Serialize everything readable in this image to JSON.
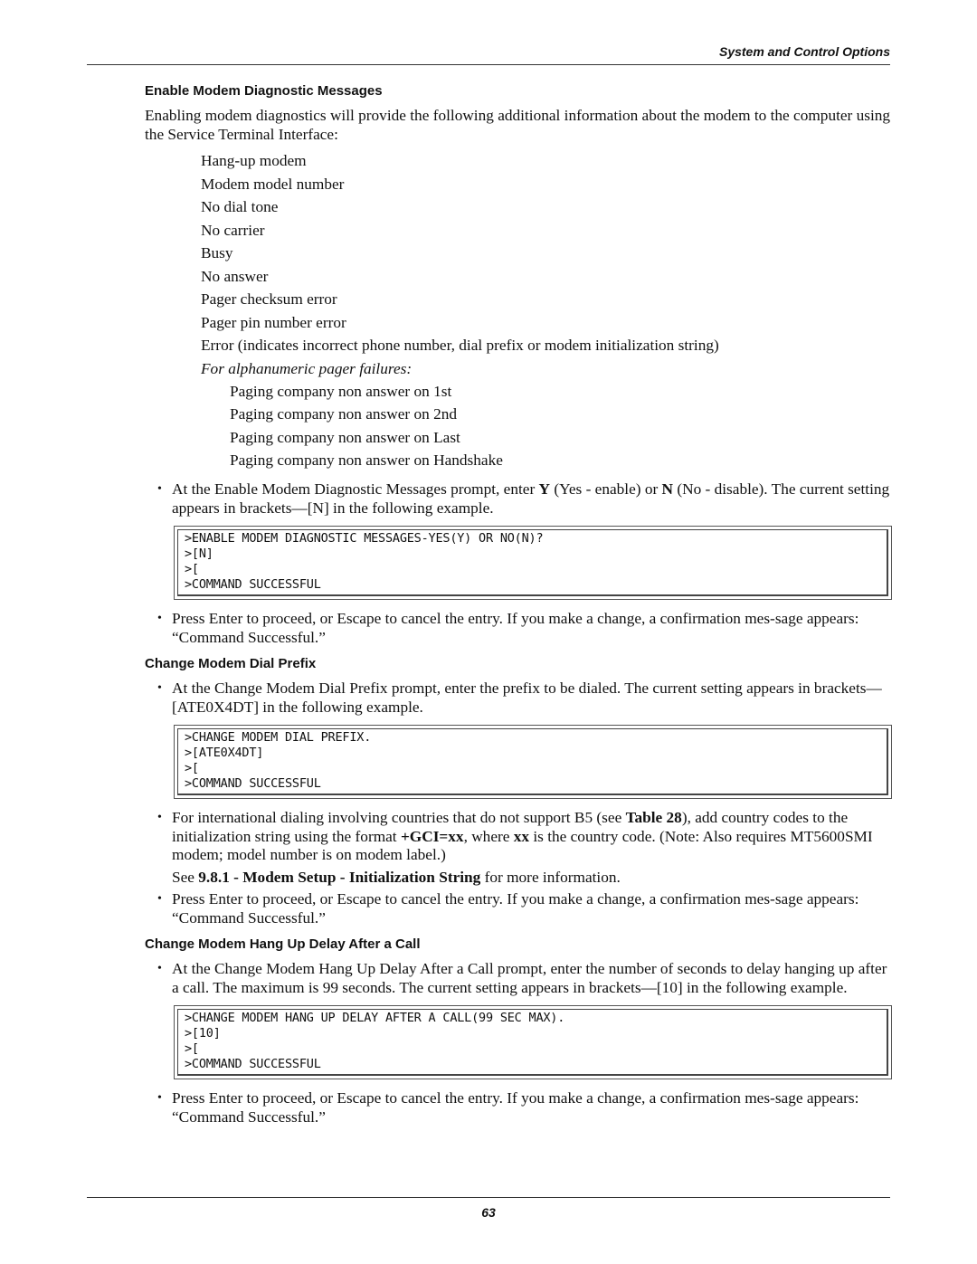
{
  "header": {
    "title": "System and Control Options"
  },
  "footer": {
    "page_number": "63"
  },
  "sections": [
    {
      "heading": "Enable Modem Diagnostic Messages",
      "intro": "Enabling modem diagnostics will provide the following additional information about the modem to the computer using the Service Terminal Interface:",
      "items": [
        "Hang-up modem",
        "Modem model number",
        "No dial tone",
        "No carrier",
        "Busy",
        "No answer",
        "Pager checksum error",
        "Pager pin number error",
        "Error (indicates incorrect phone number, dial prefix or modem initialization string)"
      ],
      "subheading": "For alphanumeric pager failures:",
      "subitems": [
        "Paging company non answer on 1st",
        "Paging company non answer on 2nd",
        "Paging company non answer on Last",
        "Paging company non answer on Handshake"
      ],
      "bullet1": {
        "pre": "At the Enable Modem Diagnostic Messages prompt, enter ",
        "y": "Y",
        "mid": " (Yes - enable) or ",
        "n": "N",
        "post": " (No - disable). The current setting appears in brackets—[N] in the following example."
      },
      "terminal": [
        ">ENABLE MODEM DIAGNOSTIC MESSAGES-YES(Y) OR NO(N)?",
        ">[N]",
        ">[",
        ">COMMAND SUCCESSFUL"
      ],
      "bullet2": "Press Enter to proceed, or Escape to cancel the entry. If you make a change, a confirmation mes-sage appears: “Command Successful.”"
    },
    {
      "heading": "Change Modem Dial Prefix",
      "bullet1": "At the Change Modem Dial Prefix prompt, enter the prefix to be dialed. The current setting appears in brackets—[ATE0X4DT] in the following example.",
      "terminal": [
        ">CHANGE MODEM DIAL PREFIX.",
        ">[ATE0X4DT]",
        ">[",
        ">COMMAND SUCCESSFUL"
      ],
      "bullet2": {
        "pre": "For international dialing involving countries that do not support B5 (see ",
        "table_ref": "Table 28",
        "mid1": "), add country codes to the initialization string using the format ",
        "format": "+GCI=xx",
        "mid2": ", where ",
        "xx": "xx",
        "post": " is the country code. (Note: Also requires MT5600SMI modem; model number is on modem label.)"
      },
      "see": {
        "pre": "See ",
        "ref": "9.8.1 - Modem Setup - Initialization String",
        "post": " for more information."
      },
      "bullet3": "Press Enter to proceed, or Escape to cancel the entry. If you make a change, a confirmation mes-sage appears: “Command Successful.”"
    },
    {
      "heading": "Change Modem Hang Up Delay After a Call",
      "bullet1": "At the Change Modem Hang Up Delay After a Call prompt, enter the number of seconds to delay hanging up after a call. The maximum is 99 seconds. The current setting appears in brackets—[10] in the following example.",
      "terminal": [
        ">CHANGE MODEM HANG UP DELAY AFTER A CALL(99 SEC MAX).",
        ">[10]",
        ">[",
        ">COMMAND SUCCESSFUL"
      ],
      "bullet2": "Press Enter to proceed, or Escape to cancel the entry. If you make a change, a confirmation mes-sage appears: “Command Successful.”"
    }
  ],
  "bullet_glyph": "•"
}
